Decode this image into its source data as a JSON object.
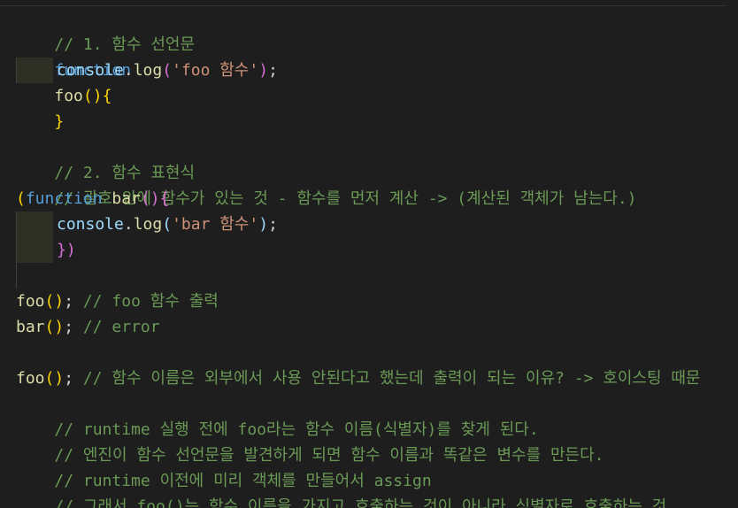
{
  "editor": {
    "lines": {
      "l1": {
        "comment": "// 1. 함수 선언문"
      },
      "l2": {
        "kw": "function",
        "name": "foo",
        "paren": "()",
        "brace": "{"
      },
      "l3": {
        "obj": "console",
        "dot": ".",
        "method": "log",
        "paren_open": "(",
        "str": "'foo 함수'",
        "paren_close": ")",
        "semi": ";"
      },
      "l4": {
        "brace": "}"
      },
      "l6": {
        "comment": "// 2. 함수 표현식"
      },
      "l7": {
        "comment": "// 괄호 안에 함수가 있는 것 - 함수를 먼저 계산 -> (계산된 객체가 남는다.)"
      },
      "l8": {
        "outer_paren": "(",
        "kw": "function",
        "name": "bar",
        "paren": "()",
        "brace": "{"
      },
      "l9": {
        "obj": "console",
        "dot": ".",
        "method": "log",
        "paren_open": "(",
        "str": "'bar 함수'",
        "paren_close": ")",
        "semi": ";"
      },
      "l10": {
        "close": "})"
      },
      "l12": {
        "name": "foo",
        "paren": "()",
        "semi": ";",
        "comment": "// foo 함수 출력"
      },
      "l13": {
        "name": "bar",
        "paren": "()",
        "semi": ";",
        "comment": "// error"
      },
      "l15": {
        "name": "foo",
        "paren": "()",
        "semi": ";",
        "comment": "// 함수 이름은 외부에서 사용 안된다고 했는데 출력이 되는 이유? -> 호이스팅 때문"
      },
      "l16": {
        "comment": "// runtime 실행 전에 foo라는 함수 이름(식별자)를 찾게 된다."
      },
      "l17": {
        "comment": "// 엔진이 함수 선언문을 발견하게 되면 함수 이름과 똑같은 변수를 만든다."
      },
      "l18": {
        "comment": "// runtime 이전에 미리 객체를 만들어서 assign"
      },
      "l19": {
        "comment": "// 그래서 foo()는 함수 이름을 가지고 호출하는 것이 아니라 식별자로 호출하는 것"
      }
    }
  },
  "colors": {
    "background": "#1e1e1e",
    "comment": "#6a9955",
    "keyword": "#569cd6",
    "function": "#dcdcaa",
    "variable": "#9cdcfe",
    "string": "#ce9178",
    "bracket_gold": "#ffd700",
    "bracket_purple": "#da70d6"
  }
}
